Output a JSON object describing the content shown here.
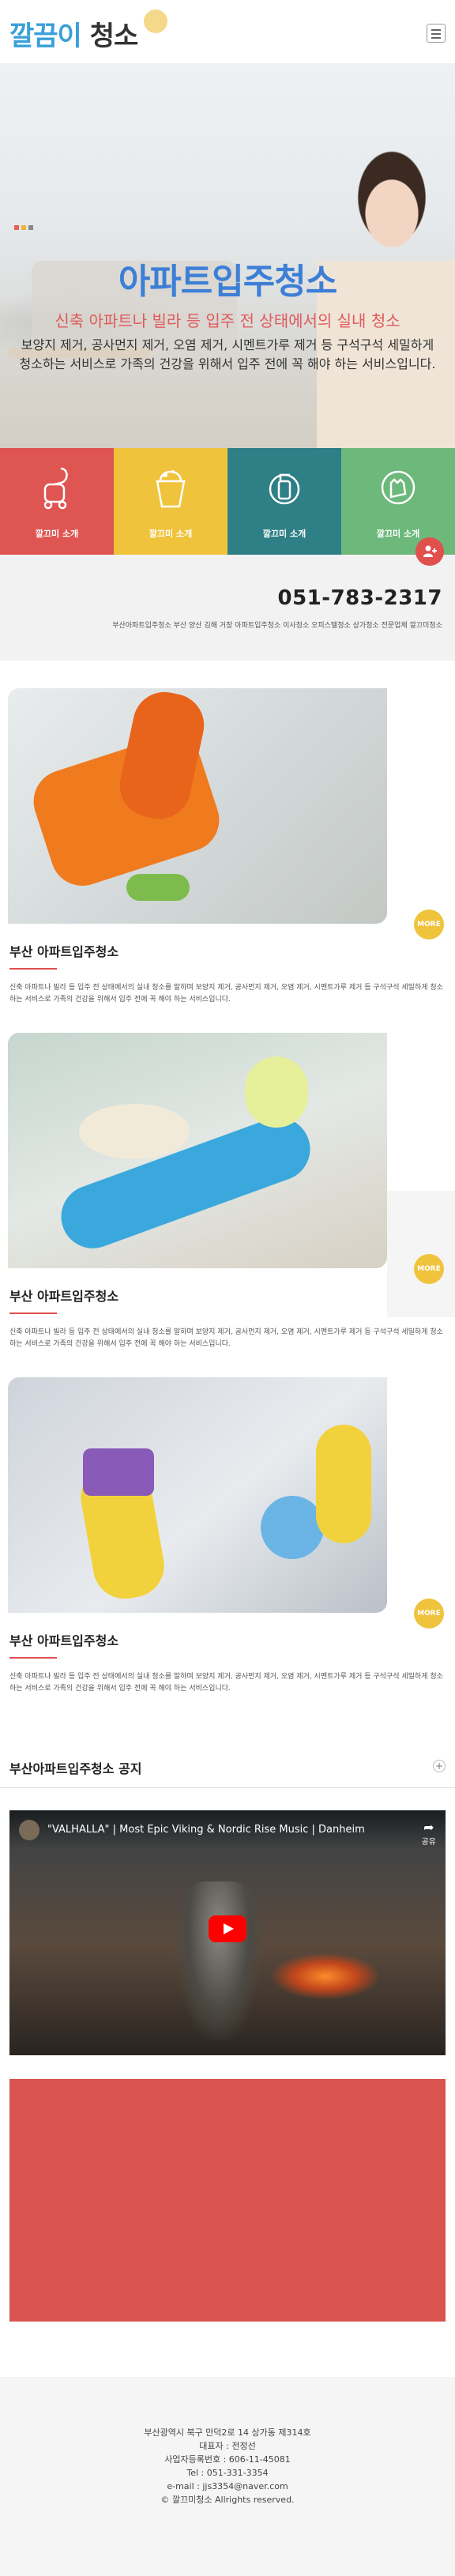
{
  "header": {
    "logo_part1": "깔끔이",
    "logo_part2": "청소"
  },
  "hero": {
    "title": "아파트입주청소",
    "subtitle": "신축 아파트나 빌라 등 입주 전 상태에서의 실내 청소",
    "description": "보양지 제거, 공사먼지 제거, 오염 제거, 시멘트가루 제거 등 구석구석 세밀하게 청소하는 서비스로 가족의 건강을 위해서 입주 전에 꼭 해야 하는 서비스입니다."
  },
  "tiles": [
    {
      "label": "깔끄미 소개",
      "color": "#de5551",
      "icon": "vacuum-icon"
    },
    {
      "label": "깔끄미 소개",
      "color": "#f0c33d",
      "icon": "bucket-icon"
    },
    {
      "label": "깔끄미 소개",
      "color": "#2f7f86",
      "icon": "spray-cleaner-icon"
    },
    {
      "label": "깔끄미 소개",
      "color": "#6db87b",
      "icon": "glove-sponge-icon"
    }
  ],
  "contact": {
    "phone": "051-783-2317",
    "tags": "부산아파트입주청소 부산 양산 김해 거창 아파트입주청소 이사청소 오피스텔청소 상가청소 전문업체 깔끄미청소"
  },
  "articles": [
    {
      "title": "부산 아파트입주청소",
      "text": "신축 아파트나 빌라 등 입주 전 상태에서의 실내 청소를 말하며 보양지 제거, 공사먼지 제거, 오염 제거, 시멘트가루 제거 등 구석구석 세밀하게 청소하는 서비스로 가족의 건강을 위해서 입주 전에 꼭 해야 하는 서비스입니다.",
      "more": "MORE"
    },
    {
      "title": "부산 아파트입주청소",
      "text": "신축 아파트나 빌라 등 입주 전 상태에서의 실내 청소를 말하며 보양지 제거, 공사먼지 제거, 오염 제거, 시멘트가루 제거 등 구석구석 세밀하게 청소하는 서비스로 가족의 건강을 위해서 입주 전에 꼭 해야 하는 서비스입니다.",
      "more": "MORE"
    },
    {
      "title": "부산 아파트입주청소",
      "text": "신축 아파트나 빌라 등 입주 전 상태에서의 실내 청소를 말하며 보양지 제거, 공사먼지 제거, 오염 제거, 시멘트가루 제거 등 구석구석 세밀하게 청소하는 서비스로 가족의 건강을 위해서 입주 전에 꼭 해야 하는 서비스입니다.",
      "more": "MORE"
    }
  ],
  "notice": {
    "title": "부산아파트입주청소 공지",
    "plus": "+"
  },
  "video": {
    "title": "\"VALHALLA\" | Most Epic Viking & Nordic Rise Music | Danheim",
    "share_label": "공유"
  },
  "footer": {
    "lines": [
      "부산광역시 북구 만덕2로 14 상가동 제314호",
      "대표자 : 전정선",
      "사업자등록번호 : 606-11-45081",
      "Tel : 051-331-3354",
      "e-mail : jjs3354@naver.com",
      "© 깔끄미청소 Allrights reserved."
    ]
  }
}
